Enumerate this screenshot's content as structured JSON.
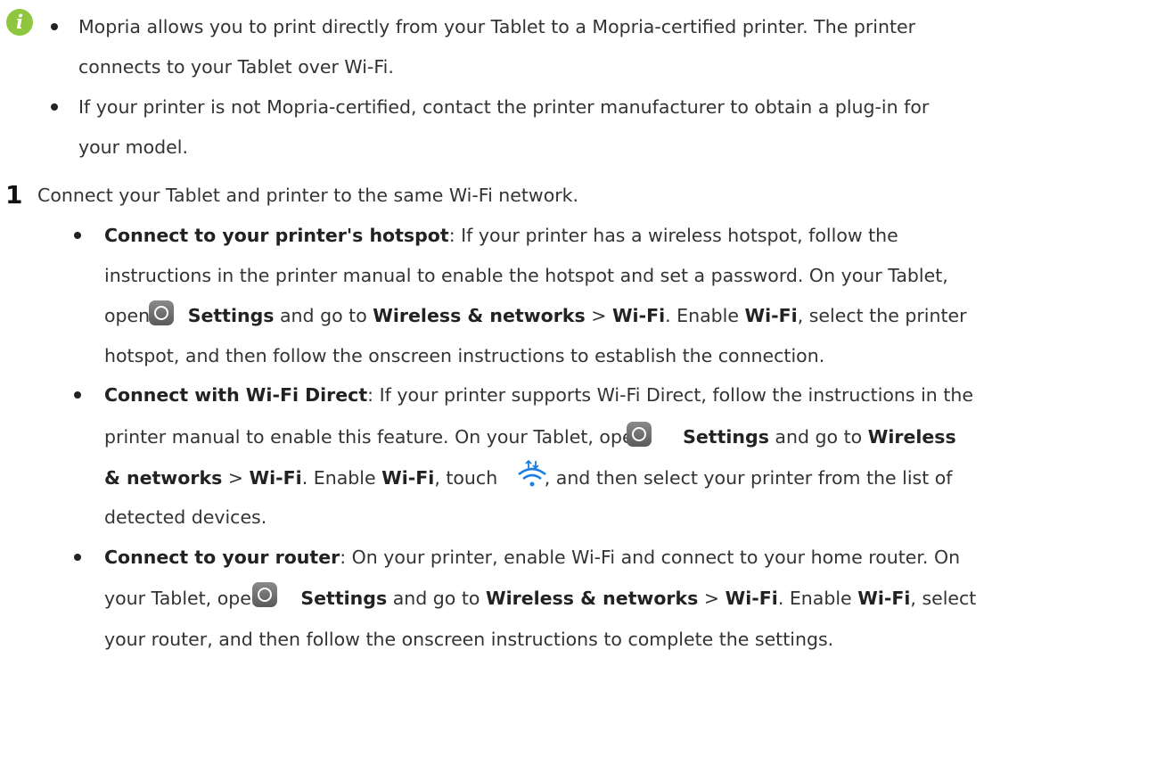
{
  "note": {
    "icon": "info-icon",
    "b1": {
      "l1": "Mopria allows you to print directly from your Tablet to a Mopria-certified printer. The printer",
      "l2": "connects to your Tablet over Wi-Fi."
    },
    "b2": {
      "l1": "If your printer is not Mopria-certified, contact the printer manufacturer to obtain a plug-in for",
      "l2": "your model."
    }
  },
  "step1": {
    "number": "1",
    "text": "Connect your Tablet and printer to the same Wi-Fi network.",
    "a": {
      "title": "Connect to your printer's hotspot",
      "l1_rest": ": If your printer has a wireless hotspot, follow the",
      "l2": "instructions in the printer manual to enable the hotspot and set a password. On your Tablet,",
      "l3_open": "open",
      "settings": "Settings",
      "go_to": "and go to",
      "wireless": "Wireless & networks",
      "gt": ">",
      "wifi": "Wi-Fi",
      "enable": ". Enable",
      "l3_end": ", select the printer",
      "l4": "hotspot, and then follow the onscreen instructions to establish the connection."
    },
    "b": {
      "title": "Connect with Wi-Fi Direct",
      "l1_rest": ": If your printer supports Wi-Fi Direct, follow the instructions in the",
      "l2_pre": "printer manual to enable this feature. On your Tablet, open",
      "settings": "Settings",
      "go_to": "and go to",
      "wireless_part": "Wireless",
      "networks_part": "& networks",
      "gt": ">",
      "wifi": "Wi-Fi",
      "enable": ". Enable",
      "touch": ", touch",
      "l3_end": ", and then select your printer from the list of",
      "l4": "detected devices.",
      "wifi_icon": "wifi-direct-icon"
    },
    "c": {
      "title": "Connect to your router",
      "l1_rest": ": On your printer, enable Wi-Fi and connect to your home router. On",
      "l2_pre": "your Tablet, open",
      "settings": "Settings",
      "go_to": "and go to",
      "wireless": "Wireless & networks",
      "gt": ">",
      "wifi": "Wi-Fi",
      "enable": ". Enable",
      "l2_end": ", select",
      "l3": "your router, and then follow the onscreen instructions to complete the settings."
    }
  },
  "icons": {
    "settings": "settings-gear-icon"
  },
  "colors": {
    "info_icon": "#8ec63f",
    "text": "#333333",
    "wifi_icon": "#1a7fe0"
  }
}
